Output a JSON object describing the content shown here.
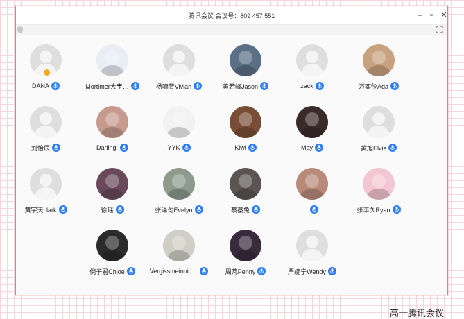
{
  "window": {
    "title": "腾讯会议 会议号：809 457 551",
    "minimize_icon": "minimize-icon",
    "maximize_icon": "maximize-icon",
    "close_icon": "close-icon"
  },
  "participants": [
    {
      "name": "DANA",
      "avatar": "default",
      "host": true
    },
    {
      "name": "Mortimer大宝…",
      "avatar": "#e9eef5"
    },
    {
      "name": "杨嘀萱Vivian",
      "avatar": "default"
    },
    {
      "name": "黄若峰Jason",
      "avatar": "#5b6f86"
    },
    {
      "name": "zack",
      "avatar": "default"
    },
    {
      "name": "万奕伶Ada",
      "avatar": "#c8a17e"
    },
    {
      "name": "刘怡辰",
      "avatar": "default"
    },
    {
      "name": "Darling.",
      "avatar": "#c79a8f"
    },
    {
      "name": "YYK",
      "avatar": "#f2f2f2"
    },
    {
      "name": "Kiwi",
      "avatar": "#7a4e36"
    },
    {
      "name": "May",
      "avatar": "#3b2a2a"
    },
    {
      "name": "黄旭Elvis",
      "avatar": "default"
    },
    {
      "name": "黄宇天clark",
      "avatar": "default"
    },
    {
      "name": "徐瑶",
      "avatar": "#6a4a5a"
    },
    {
      "name": "张泽匀Evelyn",
      "avatar": "#8d9a8c"
    },
    {
      "name": "蔡蔡兔",
      "avatar": "#5a5552"
    },
    {
      "name": ".",
      "avatar": "#b98a7a"
    },
    {
      "name": "张丰久Ryan",
      "avatar": "#f3c6d3"
    },
    {
      "name": "倪子君Chloe",
      "avatar": "#2b2b2b"
    },
    {
      "name": "Vergissmeinnic…",
      "avatar": "#cfcfc5"
    },
    {
      "name": "周芃Penny",
      "avatar": "#3a2a3e"
    },
    {
      "name": "严婉宁Wendy",
      "avatar": "default"
    }
  ],
  "caption": "高一腾讯会议",
  "colors": {
    "mic": "#2b7cf6",
    "host_badge": "#f5a623",
    "frame": "#e77b84"
  }
}
